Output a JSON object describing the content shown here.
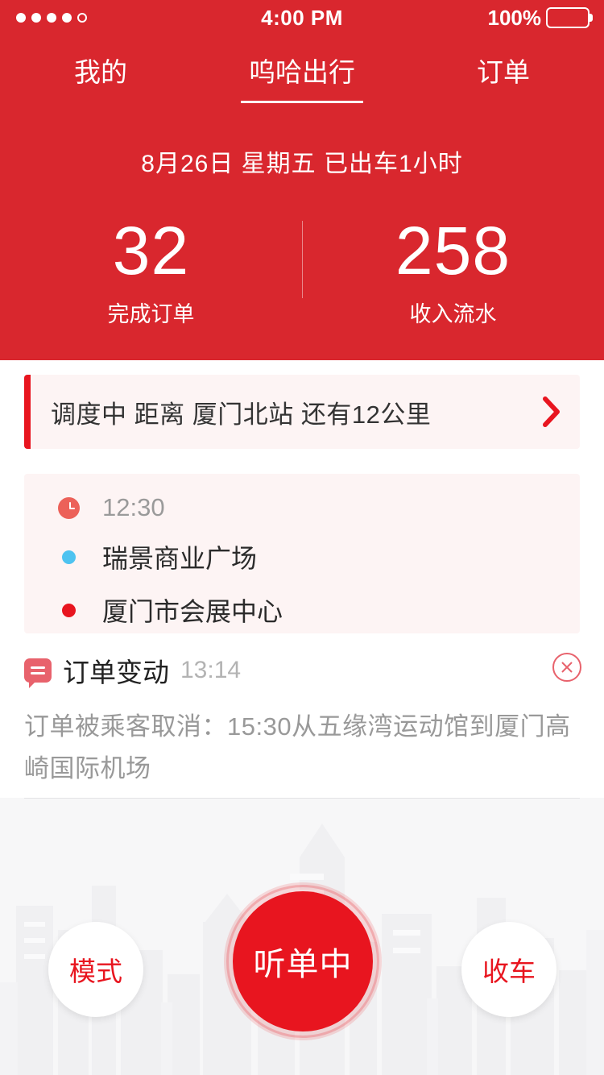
{
  "status_bar": {
    "signal_dots": 5,
    "signal_filled": 4,
    "time": "4:00 PM",
    "battery_percent": "100%"
  },
  "tabs": [
    {
      "label": "我的",
      "active": false
    },
    {
      "label": "呜哈出行",
      "active": true
    },
    {
      "label": "订单",
      "active": false
    }
  ],
  "header": {
    "date_line": "8月26日  星期五  已出车1小时",
    "stats": [
      {
        "value": "32",
        "label": "完成订单"
      },
      {
        "value": "258",
        "label": "收入流水"
      }
    ]
  },
  "dispatch": {
    "text": "调度中  距离 厦门北站 还有12公里",
    "chevron": "chevron-right-icon"
  },
  "trip": {
    "time": "12:30",
    "origin": "瑞景商业广场",
    "destination": "厦门市会展中心"
  },
  "notification": {
    "title": "订单变动",
    "time": "13:14",
    "body": "订单被乘客取消：15:30从五缘湾运动馆到厦门高崎国际机场",
    "close_label": "×"
  },
  "actions": {
    "mode_label": "模式",
    "listen_label": "听单中",
    "offwork_label": "收车"
  },
  "colors": {
    "brand_red": "#D9272E",
    "accent_red": "#E8151F",
    "card_pink": "#FDF4F4",
    "origin_dot": "#4EC3F0",
    "dest_dot": "#E8151F",
    "muted_text": "#999999",
    "bottom_bg": "#F7F7F8"
  }
}
